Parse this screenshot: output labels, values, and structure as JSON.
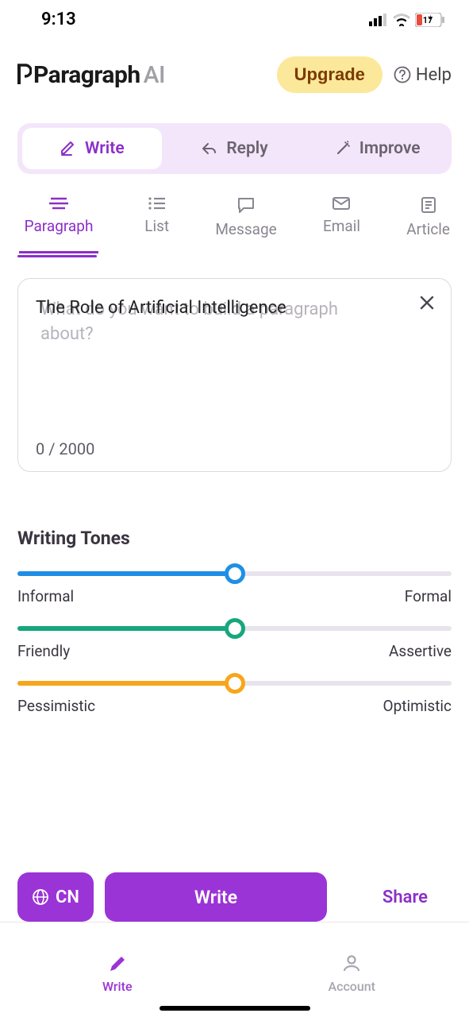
{
  "status": {
    "time": "9:13",
    "battery": "17"
  },
  "header": {
    "logo_main": "Paragraph",
    "logo_suffix": "AI",
    "upgrade": "Upgrade",
    "help": "Help"
  },
  "mode_tabs": {
    "write": "Write",
    "reply": "Reply",
    "improve": "Improve"
  },
  "type_tabs": {
    "paragraph": "Paragraph",
    "list": "List",
    "message": "Message",
    "email": "Email",
    "article": "Article"
  },
  "input": {
    "placeholder": "What do you want to build a paragraph about?",
    "value": "The Role of Artificial Intelligence",
    "char_count": "0 / 2000"
  },
  "tones": {
    "title": "Writing Tones",
    "sliders": [
      {
        "left": "Informal",
        "right": "Formal",
        "color": "#1f8fe5",
        "value": 50
      },
      {
        "left": "Friendly",
        "right": "Assertive",
        "color": "#16a77e",
        "value": 50
      },
      {
        "left": "Pessimistic",
        "right": "Optimistic",
        "color": "#f7a61b",
        "value": 50
      }
    ]
  },
  "actions": {
    "lang": "CN",
    "write": "Write",
    "share": "Share"
  },
  "nav": {
    "write": "Write",
    "account": "Account"
  }
}
